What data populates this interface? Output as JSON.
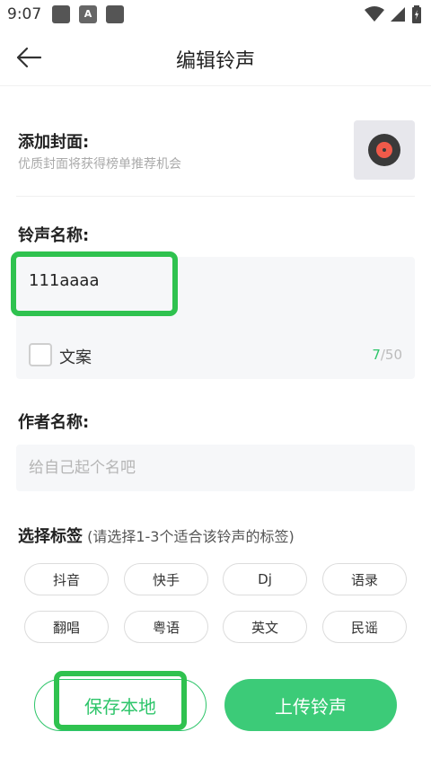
{
  "status_bar": {
    "time": "9:07",
    "notification_icon_b": "A"
  },
  "header": {
    "back_icon": "back-arrow-icon",
    "title": "编辑铃声"
  },
  "cover": {
    "title": "添加封面:",
    "subtitle": "优质封面将获得榜单推荐机会",
    "thumb_icon": "vinyl-record-icon"
  },
  "ringtone": {
    "title": "铃声名称:",
    "name_value": "111aaaa",
    "checkbox_label": "文案",
    "count_current": "7",
    "count_max": "/50"
  },
  "author": {
    "title": "作者名称:",
    "placeholder": "给自己起个名吧"
  },
  "tags": {
    "title": "选择标签",
    "hint": " (请选择1-3个适合该铃声的标签)",
    "items": [
      "抖音",
      "快手",
      "Dj",
      "语录",
      "翻唱",
      "粤语",
      "英文",
      "民谣"
    ]
  },
  "actions": {
    "save_label": "保存本地",
    "upload_label": "上传铃声"
  },
  "colors": {
    "accent": "#2ec56a",
    "upload_bg": "#3ccb78",
    "highlight": "#2fc24f"
  }
}
